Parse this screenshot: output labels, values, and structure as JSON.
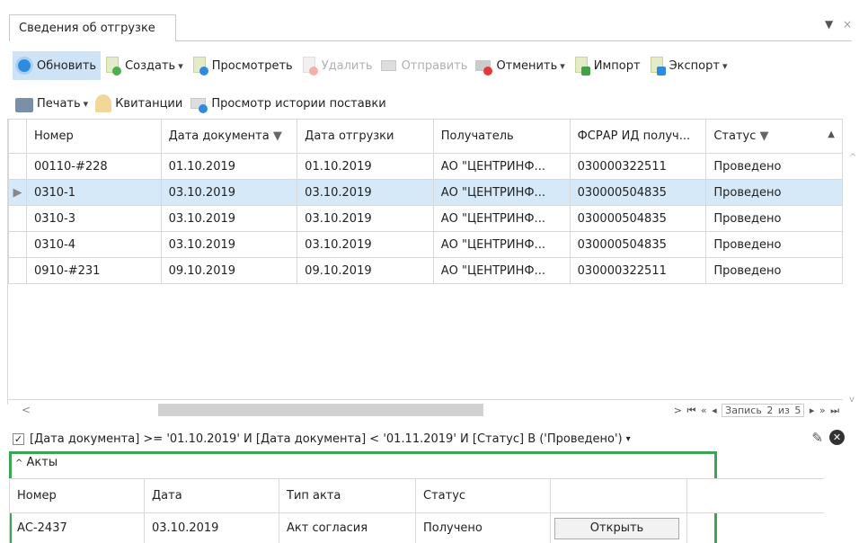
{
  "tab": {
    "title": "Сведения об отгрузке"
  },
  "toolbar": {
    "refresh": "Обновить",
    "create": "Создать",
    "view": "Просмотреть",
    "delete": "Удалить",
    "send": "Отправить",
    "cancel": "Отменить",
    "import": "Импорт",
    "export": "Экспорт",
    "print": "Печать",
    "receipts": "Квитанции",
    "history": "Просмотр истории поставки"
  },
  "grid": {
    "columns": [
      "Номер",
      "Дата документа",
      "Дата отгрузки",
      "Получатель",
      "ФСРАР ИД получ...",
      "Статус"
    ],
    "rows": [
      {
        "num": "00110-#228",
        "doc_date": "01.10.2019",
        "ship_date": "01.10.2019",
        "recipient": "АО \"ЦЕНТРИНФ...",
        "fsrar": "030000322511",
        "status": "Проведено"
      },
      {
        "num": "0310-1",
        "doc_date": "03.10.2019",
        "ship_date": "03.10.2019",
        "recipient": "АО \"ЦЕНТРИНФ...",
        "fsrar": "030000504835",
        "status": "Проведено"
      },
      {
        "num": "0310-3",
        "doc_date": "03.10.2019",
        "ship_date": "03.10.2019",
        "recipient": "АО \"ЦЕНТРИНФ...",
        "fsrar": "030000504835",
        "status": "Проведено"
      },
      {
        "num": "0310-4",
        "doc_date": "03.10.2019",
        "ship_date": "03.10.2019",
        "recipient": "АО \"ЦЕНТРИНФ...",
        "fsrar": "030000504835",
        "status": "Проведено"
      },
      {
        "num": "0910-#231",
        "doc_date": "09.10.2019",
        "ship_date": "09.10.2019",
        "recipient": "АО \"ЦЕНТРИНФ...",
        "fsrar": "030000322511",
        "status": "Проведено"
      }
    ],
    "record_info": "Запись 2 из 5"
  },
  "filter": {
    "text": "[Дата документа] >= '01.10.2019' И [Дата документа] < '01.11.2019' И [Статус] В ('Проведено')"
  },
  "acts": {
    "title": "Акты",
    "columns": [
      "Номер",
      "Дата",
      "Тип акта",
      "Статус"
    ],
    "row": {
      "num": "АС-2437",
      "date": "03.10.2019",
      "type": "Акт согласия",
      "status": "Получено",
      "open": "Открыть"
    }
  }
}
